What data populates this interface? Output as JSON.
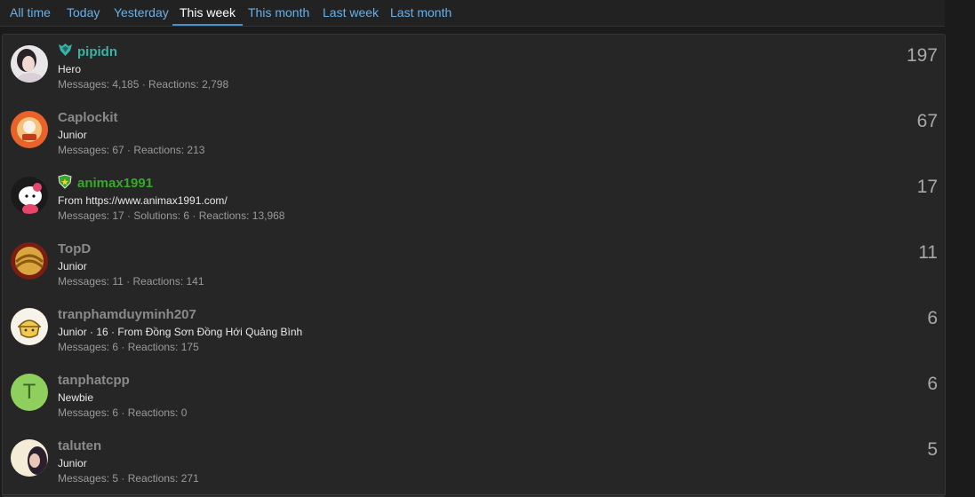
{
  "tabs": [
    {
      "label": "All time"
    },
    {
      "label": "Today"
    },
    {
      "label": "Yesterday"
    },
    {
      "label": "This week"
    },
    {
      "label": "This month"
    },
    {
      "label": "Last week"
    },
    {
      "label": "Last month"
    }
  ],
  "active_tab": "This week",
  "colors": {
    "link": "#6ab0e8",
    "teal_user": "#3bb2a6",
    "green_user": "#37a82a"
  },
  "members": [
    {
      "username": "pipidn",
      "title": "Hero",
      "stats": "Messages: 4,185 · Reactions: 2,798",
      "count": "197",
      "badge_icon": "wings-crest-icon"
    },
    {
      "username": "Caplockit",
      "title": "Junior",
      "stats": "Messages: 67 · Reactions: 213",
      "count": "67"
    },
    {
      "username": "animax1991",
      "title": "From https://www.animax1991.com/",
      "stats": "Messages: 17 · Solutions: 6 · Reactions: 13,968",
      "count": "17",
      "badge_icon": "shield-star-icon"
    },
    {
      "username": "TopD",
      "title": "Junior",
      "stats": "Messages: 11 · Reactions: 141",
      "count": "11"
    },
    {
      "username": "tranphamduyminh207",
      "title": "Junior · 16 · From Đồng Sơn Đồng Hới Quảng Bình",
      "stats": "Messages: 6 · Reactions: 175",
      "count": "6"
    },
    {
      "username": "tanphatcpp",
      "title": "Newbie",
      "stats": "Messages: 6 · Reactions: 0",
      "count": "6",
      "avatar_letter": "T"
    },
    {
      "username": "taluten",
      "title": "Junior",
      "stats": "Messages: 5 · Reactions: 271",
      "count": "5"
    }
  ]
}
